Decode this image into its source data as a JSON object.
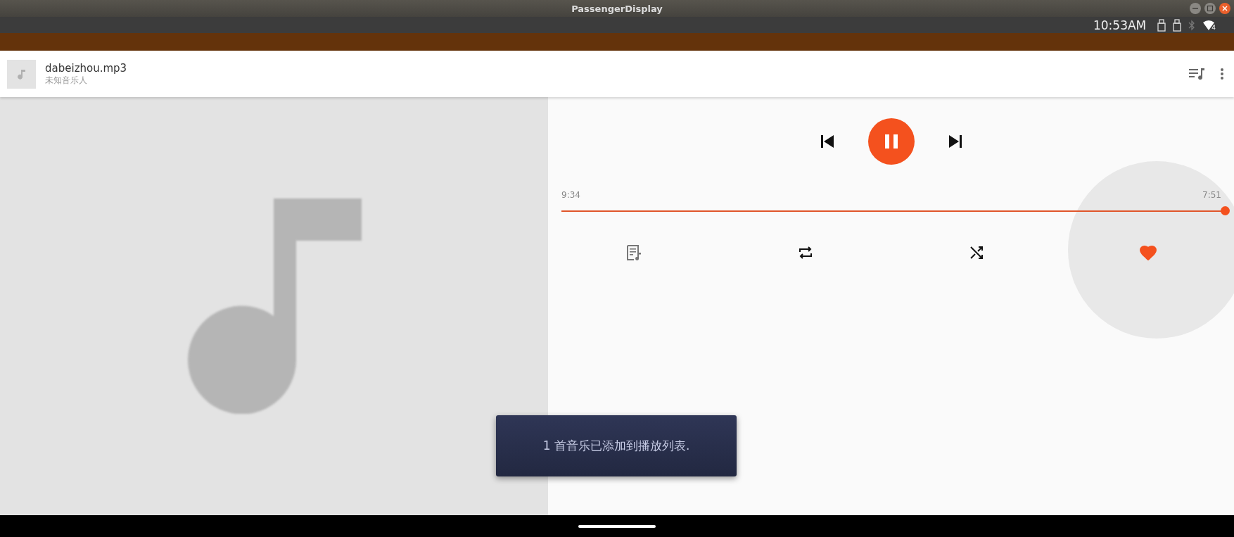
{
  "window": {
    "title": "PassengerDisplay"
  },
  "status_bar": {
    "time": "10:53AM",
    "wifi_badge": "4",
    "bluetooth_on": false
  },
  "track": {
    "title": "dabeizhou.mp3",
    "artist": "未知音乐人"
  },
  "player": {
    "playing": true,
    "elapsed": "9:34",
    "duration": "7:51",
    "level": 1.0,
    "favorite": true,
    "favorite_pressed": true
  },
  "toast": {
    "message": "1 首音乐已添加到播放列表."
  }
}
